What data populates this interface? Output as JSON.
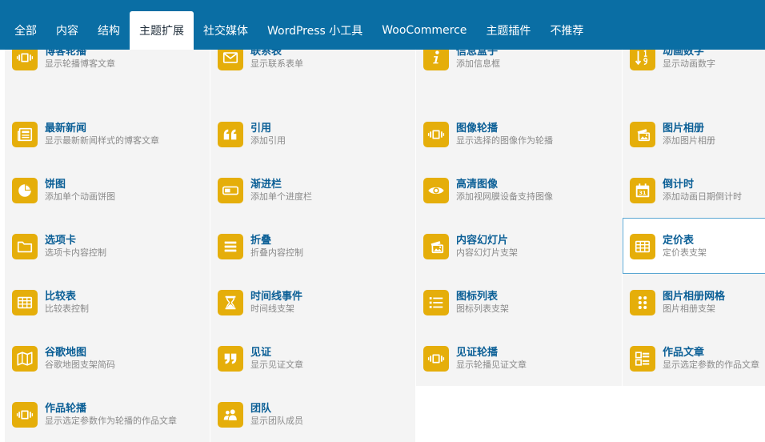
{
  "nav": {
    "tabs": [
      "全部",
      "内容",
      "结构",
      "主题扩展",
      "社交媒体",
      "WordPress 小工具",
      "WooCommerce",
      "主题插件",
      "不推荐"
    ],
    "active_tab": "主题扩展"
  },
  "colors": {
    "nav_bg": "#0a6ea4",
    "icon_bg": "#e5ae0a",
    "title": "#0b5f96",
    "desc": "#8a8a8a",
    "tile_bg": "#f4f4f4",
    "highlight_border": "#5aa6d2"
  },
  "widgets": [
    {
      "title": "博客轮播",
      "desc": "显示轮播博客文章",
      "icon": "carousel-icon"
    },
    {
      "title": "联系表",
      "desc": "显示联系表单",
      "icon": "envelope-icon"
    },
    {
      "title": "信息盒子",
      "desc": "添加信息框",
      "icon": "info-icon"
    },
    {
      "title": "动画数字",
      "desc": "显示动画数字",
      "icon": "sort-numeric-icon"
    },
    {
      "title": "最新新闻",
      "desc": "显示最新新闻样式的博客文章",
      "icon": "newspaper-icon"
    },
    {
      "title": "引用",
      "desc": "添加引用",
      "icon": "quote-left-icon"
    },
    {
      "title": "图像轮播",
      "desc": "显示选择的图像作为轮播",
      "icon": "carousel-icon"
    },
    {
      "title": "图片相册",
      "desc": "添加图片相册",
      "icon": "photo-gallery-icon"
    },
    {
      "title": "饼图",
      "desc": "添加单个动画饼图",
      "icon": "pie-chart-icon"
    },
    {
      "title": "渐进栏",
      "desc": "添加单个进度栏",
      "icon": "progress-bar-icon"
    },
    {
      "title": "高清图像",
      "desc": "添加视网膜设备支持图像",
      "icon": "eye-icon"
    },
    {
      "title": "倒计时",
      "desc": "添加动画日期倒计时",
      "icon": "calendar-icon"
    },
    {
      "title": "选项卡",
      "desc": "选项卡内容控制",
      "icon": "folder-icon"
    },
    {
      "title": "折叠",
      "desc": "折叠内容控制",
      "icon": "bars-icon"
    },
    {
      "title": "内容幻灯片",
      "desc": "内容幻灯片支架",
      "icon": "photo-gallery-icon"
    },
    {
      "title": "定价表",
      "desc": "定价表支架",
      "icon": "table-icon"
    },
    {
      "title": "比较表",
      "desc": "比较表控制",
      "icon": "table-icon"
    },
    {
      "title": "时间线事件",
      "desc": "时间线支架",
      "icon": "hourglass-icon"
    },
    {
      "title": "图标列表",
      "desc": "图标列表支架",
      "icon": "list-icon"
    },
    {
      "title": "图片相册网格",
      "desc": "图片相册支架",
      "icon": "dots-grid-icon"
    },
    {
      "title": "谷歌地图",
      "desc": "谷歌地图支架简码",
      "icon": "map-icon"
    },
    {
      "title": "见证",
      "desc": "显示见证文章",
      "icon": "quote-right-icon"
    },
    {
      "title": "见证轮播",
      "desc": "显示轮播见证文章",
      "icon": "carousel-icon"
    },
    {
      "title": "作品文章",
      "desc": "显示选定参数的作品文章",
      "icon": "portfolio-list-icon"
    },
    {
      "title": "作品轮播",
      "desc": "显示选定参数作为轮播的作品文章",
      "icon": "carousel-icon"
    },
    {
      "title": "团队",
      "desc": "显示团队成员",
      "icon": "users-icon"
    }
  ]
}
